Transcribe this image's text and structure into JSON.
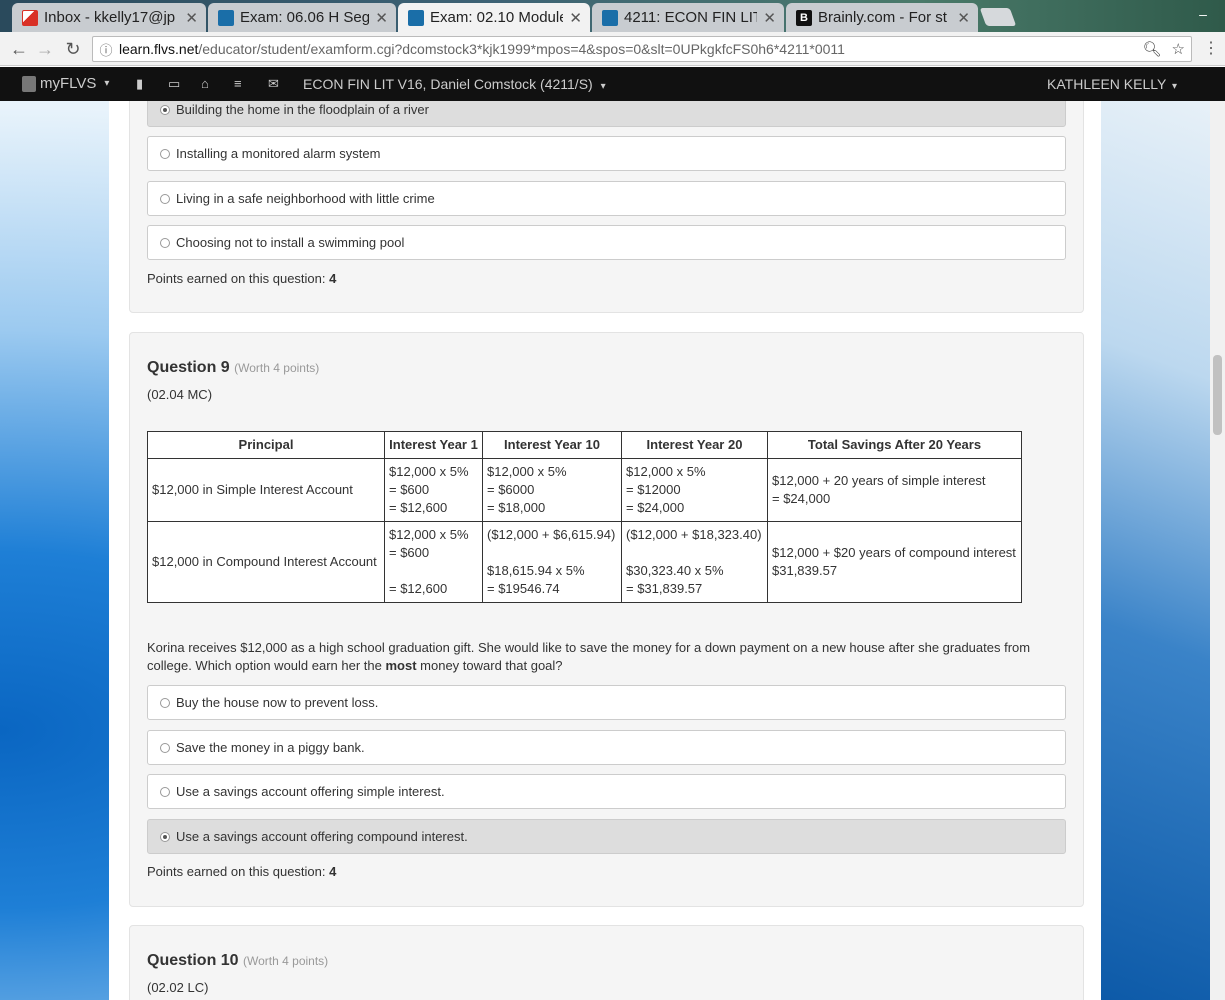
{
  "browser": {
    "tabs": [
      {
        "title": "Inbox - kkelly17@jp",
        "icon": "gmail-icon",
        "active": false
      },
      {
        "title": "Exam: 06.06 H Segm",
        "icon": "flvs-icon",
        "active": false
      },
      {
        "title": "Exam: 02.10 Module",
        "icon": "flvs-icon",
        "active": true
      },
      {
        "title": "4211: ECON FIN LIT",
        "icon": "flvs-icon",
        "active": false
      },
      {
        "title": "Brainly.com - For st",
        "icon": "brainly-icon",
        "active": false
      }
    ],
    "url_host": "learn.flvs.net",
    "url_path": "/educator/student/examform.cgi?dcomstock3*kjk1999*mpos=4&spos=0&slt=0UPkgkfcFS0h6*4211*0011"
  },
  "navbar": {
    "logo": "myFLVS",
    "course": "ECON FIN LIT V16, Daniel Comstock (4211/S)",
    "user": "KATHLEEN KELLY"
  },
  "q8": {
    "options": [
      {
        "label": "Building the home in the floodplain of a river",
        "selected": true
      },
      {
        "label": "Installing a monitored alarm system",
        "selected": false
      },
      {
        "label": "Living in a safe neighborhood with little crime",
        "selected": false
      },
      {
        "label": "Choosing not to install a swimming pool",
        "selected": false
      }
    ],
    "points_label": "Points earned on this question: ",
    "points": "4"
  },
  "q9": {
    "title": "Question 9",
    "worth": "(Worth 4 points)",
    "code": "(02.04 MC)",
    "table": {
      "headers": [
        "Principal",
        "Interest Year 1",
        "Interest Year 10",
        "Interest Year 20",
        "Total Savings After 20 Years"
      ],
      "rows": [
        {
          "principal": "$12,000 in Simple Interest Account",
          "y1": [
            "$12,000 x 5%",
            "= $600",
            "= $12,600"
          ],
          "y10": [
            "$12,000 x 5%",
            "= $6000",
            "= $18,000"
          ],
          "y20": [
            "$12,000 x 5%",
            "= $12000",
            "= $24,000"
          ],
          "total": [
            "$12,000 + 20 years of simple interest",
            "= $24,000"
          ]
        },
        {
          "principal": "$12,000 in Compound Interest Account",
          "y1": [
            "$12,000 x 5%",
            "= $600",
            "",
            "= $12,600"
          ],
          "y10": [
            "($12,000 + $6,615.94)",
            "",
            "$18,615.94 x 5%",
            "= $19546.74"
          ],
          "y20": [
            "($12,000 + $18,323.40)",
            "",
            "$30,323.40 x 5%",
            "= $31,839.57"
          ],
          "total": [
            "$12,000 + $20 years of compound interest",
            "$31,839.57"
          ]
        }
      ]
    },
    "question_pre": "Korina receives $12,000 as a high school graduation gift. She would like to save the money for a down payment on a new house after she graduates from college. Which option would earn her the ",
    "question_bold": "most",
    "question_post": " money toward that goal?",
    "options": [
      {
        "label": "Buy the house now to prevent loss.",
        "selected": false
      },
      {
        "label": "Save the money in a piggy bank.",
        "selected": false
      },
      {
        "label": "Use a savings account offering simple interest.",
        "selected": false
      },
      {
        "label": "Use a savings account offering compound interest.",
        "selected": true
      }
    ],
    "points_label": "Points earned on this question: ",
    "points": "4"
  },
  "q10": {
    "title": "Question 10",
    "worth": "(Worth 4 points)",
    "code": "(02.02 LC)"
  }
}
